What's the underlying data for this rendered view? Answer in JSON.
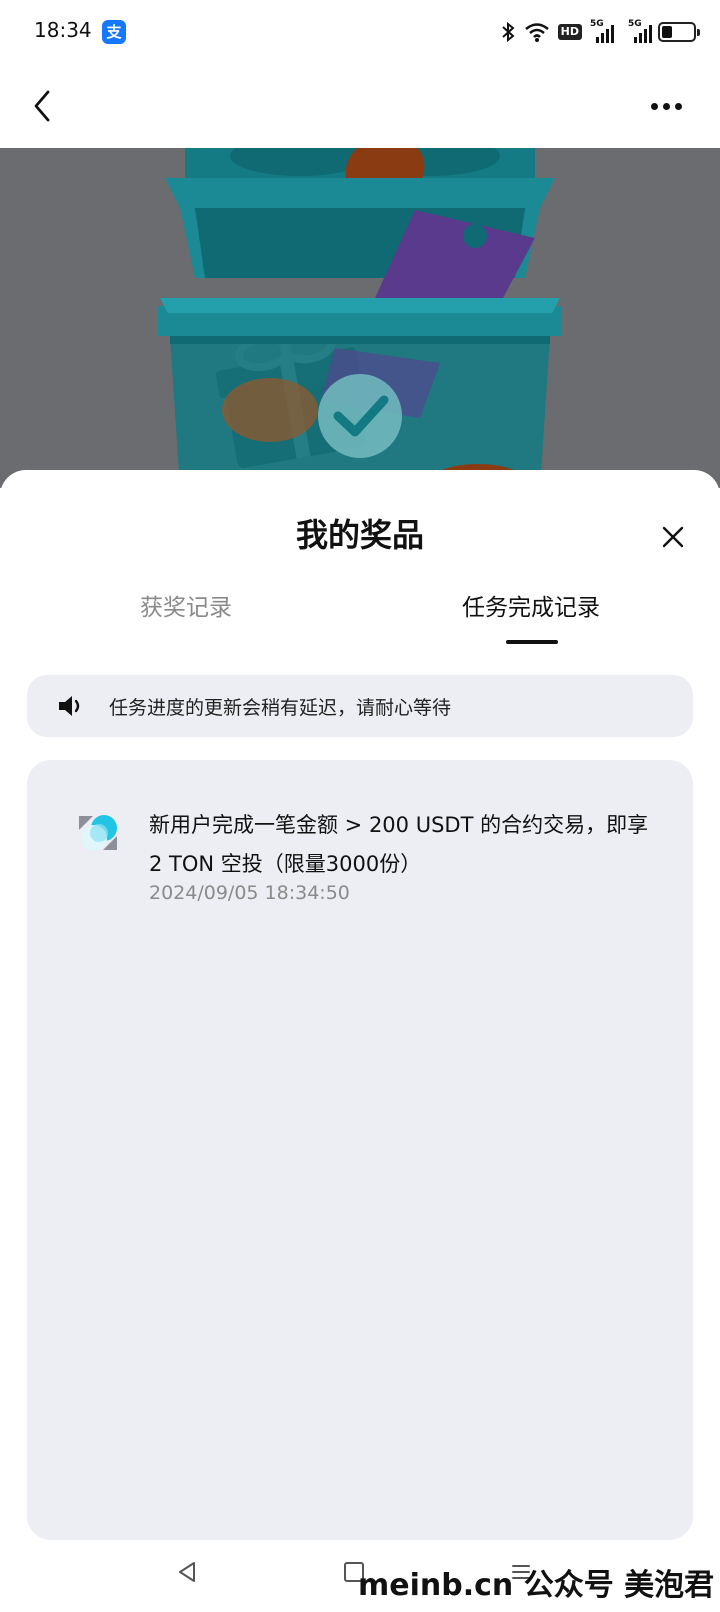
{
  "status_bar": {
    "time": "18:34",
    "app_badge": "支",
    "hd_label": "HD",
    "signal_1_label": "5G",
    "signal_2_label": "5G"
  },
  "nav": {
    "back_icon": "chevron-left-icon",
    "more_icon": "more-dots-icon"
  },
  "sheet": {
    "title": "我的奖品",
    "tabs": [
      {
        "label": "获奖记录",
        "active": false
      },
      {
        "label": "任务完成记录",
        "active": true
      }
    ],
    "notice": "任务进度的更新会稍有延迟，请耐心等待",
    "records": [
      {
        "title": "新用户完成一笔金额 > 200 USDT 的合约交易，即享2 TON 空投（限量3000份）",
        "time": "2024/09/05 18:34:50"
      }
    ]
  },
  "watermark": "meinb.cn 公众号 美泡君",
  "colors": {
    "accent_tab_indicator": "#111111",
    "card_background": "#eceef3",
    "banner_background": "#6b6c70",
    "chest_teal": "#1b8a95",
    "ticket_purple": "#5a3a8c",
    "coin_orange": "#8a3b12"
  }
}
